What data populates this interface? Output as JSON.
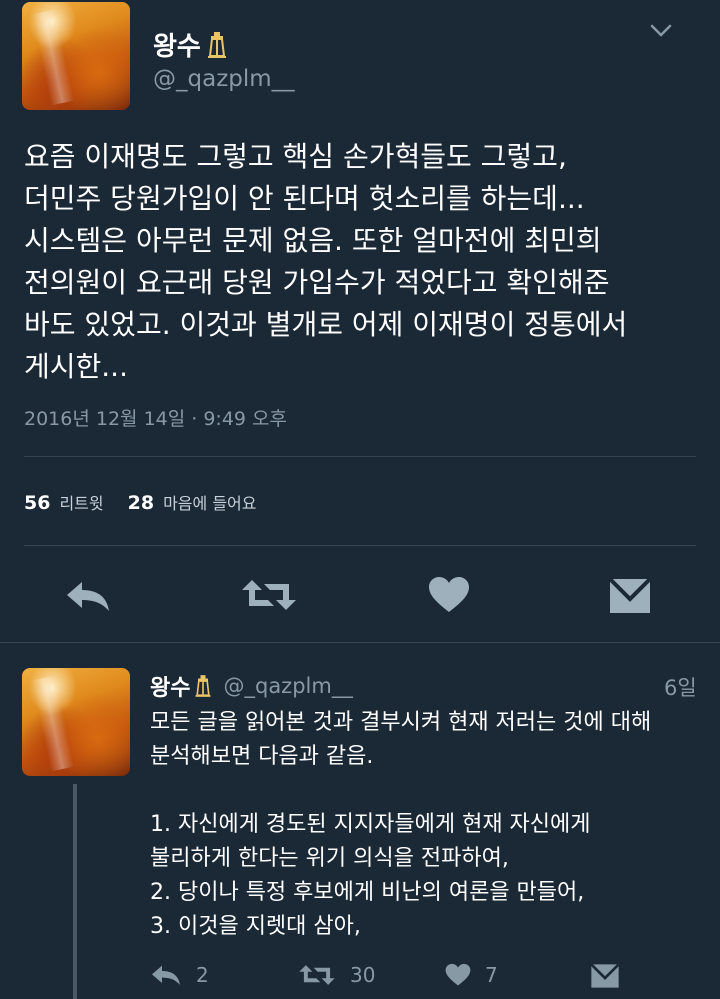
{
  "main_tweet": {
    "author_name": "왕수",
    "author_handle": "@_qazplm__",
    "text": "요즘 이재명도 그렇고 핵심 손가혁들도 그렇고,\n더민주 당원가입이 안 된다며 헛소리를 하는데...\n시스템은 아무런 문제 없음. 또한 얼마전에 최민희\n전의원이 요근래 당원 가입수가 적었다고 확인해준\n바도 있었고. 이것과 별개로 어제 이재명이 정통에서\n게시한...",
    "timestamp": "2016년 12월 14일 · 9:49 오후",
    "retweets": "56",
    "retweets_label": "리트윗",
    "likes": "28",
    "likes_label": "마음에 들어요"
  },
  "reply_tweet": {
    "author_name": "왕수",
    "author_handle": "@_qazplm__",
    "age": "6일",
    "text": "모든 글을 읽어본 것과 결부시켜 현재 저러는 것에 대해\n분석해보면 다음과 같음.\n\n1. 자신에게 경도된 지지자들에게 현재 자신에게\n불리하게 한다는 위기 의식을 전파하여,\n2. 당이나 특정 후보에게 비난의 여론을 만들어,\n3. 이것을 지렛대 삼아,",
    "reply_count": "2",
    "retweet_count": "30",
    "like_count": "7"
  },
  "icons": {
    "chevron": "chevron-down-icon",
    "badge": "lantern-badge-icon",
    "reply": "reply-icon",
    "retweet": "retweet-icon",
    "like": "heart-icon",
    "dm": "envelope-icon"
  },
  "colors": {
    "background": "#1b2836",
    "secondary_text": "#8899a6",
    "divider": "#38444d",
    "action_icon": "#9fb0bd"
  }
}
